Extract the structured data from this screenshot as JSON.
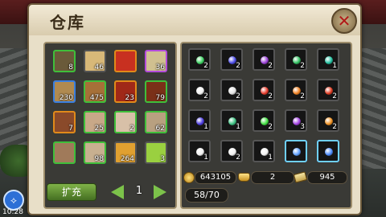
{
  "window": {
    "title": "仓库"
  },
  "left_grid": [
    {
      "count": "8",
      "border": "green",
      "fill": "#6a5a3a"
    },
    {
      "count": "46",
      "border": "dark",
      "fill": "#d8b878"
    },
    {
      "count": "",
      "border": "orange",
      "fill": "#c83020"
    },
    {
      "count": "36",
      "border": "purple",
      "fill": "#d0c090"
    },
    {
      "count": "230",
      "border": "blue",
      "fill": "#b08a50"
    },
    {
      "count": "475",
      "border": "green",
      "fill": "#a67038"
    },
    {
      "count": "23",
      "border": "orange",
      "fill": "#a02818"
    },
    {
      "count": "79",
      "border": "green",
      "fill": "#7a3018"
    },
    {
      "count": "7",
      "border": "orange",
      "fill": "#8a4a2a"
    },
    {
      "count": "25",
      "border": "green",
      "fill": "#c8a888"
    },
    {
      "count": "2",
      "border": "green",
      "fill": "#d8c0a8"
    },
    {
      "count": "62",
      "border": "green",
      "fill": "#b8a080"
    },
    {
      "count": "",
      "border": "green",
      "fill": "#a07a5a"
    },
    {
      "count": "98",
      "border": "green",
      "fill": "#c8b090"
    },
    {
      "count": "264",
      "border": "dark",
      "fill": "#e0a030"
    },
    {
      "count": "3",
      "border": "dark",
      "fill": "#9ad040"
    }
  ],
  "right_grid": [
    {
      "count": "2",
      "color": "#3ad060",
      "border": "dark"
    },
    {
      "count": "2",
      "color": "#4a4ae8",
      "border": "dark"
    },
    {
      "count": "2",
      "color": "#9a40d8",
      "border": "dark"
    },
    {
      "count": "2",
      "color": "#30c060",
      "border": "dark"
    },
    {
      "count": "1",
      "color": "#20c0a0",
      "border": "dark"
    },
    {
      "count": "2",
      "color": "#f0f0f0",
      "border": "dark"
    },
    {
      "count": "2",
      "color": "#e0e0e0",
      "border": "dark"
    },
    {
      "count": "2",
      "color": "#e83a2a",
      "border": "dark"
    },
    {
      "count": "2",
      "color": "#f08020",
      "border": "dark"
    },
    {
      "count": "2",
      "color": "#e03a20",
      "border": "dark"
    },
    {
      "count": "1",
      "color": "#4a3ae0",
      "border": "dark"
    },
    {
      "count": "1",
      "color": "#3ac080",
      "border": "dark"
    },
    {
      "count": "2",
      "color": "#40e040",
      "border": "dark"
    },
    {
      "count": "3",
      "color": "#a040e0",
      "border": "dark"
    },
    {
      "count": "2",
      "color": "#f09020",
      "border": "dark"
    },
    {
      "count": "1",
      "color": "#f0f0f0",
      "border": "dark"
    },
    {
      "count": "2",
      "color": "#f0f0f0",
      "border": "dark"
    },
    {
      "count": "1",
      "color": "#f0f0f0",
      "border": "dark"
    },
    {
      "count": "",
      "color": "#60a0ff",
      "border": "bright"
    },
    {
      "count": "",
      "color": "#4a8aff",
      "border": "bright"
    }
  ],
  "controls": {
    "expand_label": "扩充",
    "page": "1"
  },
  "currency": {
    "gold": "643105",
    "ingot": "2",
    "ticket": "945"
  },
  "capacity": "58/70",
  "status": {
    "time": "10:28"
  }
}
